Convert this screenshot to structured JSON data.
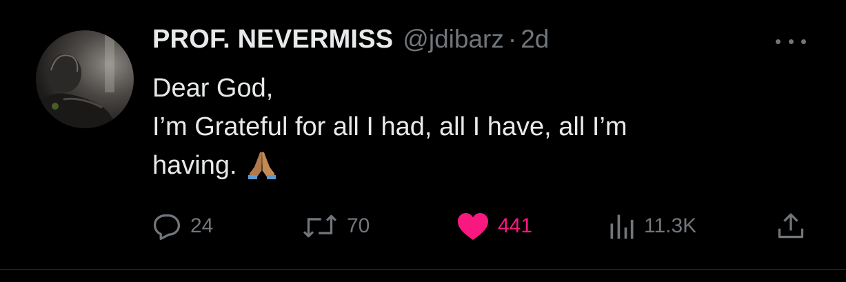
{
  "tweet": {
    "author_name": "PROF. NEVERMISS",
    "handle": "@jdibarz",
    "separator": "·",
    "time": "2d",
    "text_lines": [
      "Dear God,",
      "I’m Grateful for all I had, all I have, all I’m",
      "having."
    ],
    "emoji": "folded-hands-emoji"
  },
  "actions": {
    "reply_count": "24",
    "retweet_count": "70",
    "like_count": "441",
    "view_count": "11.3K"
  },
  "colors": {
    "background": "#000000",
    "primary_text": "#e7e9ea",
    "secondary_text": "#71767b",
    "like_active": "#f91880",
    "divider": "#2f3336"
  },
  "icons": {
    "more": "more-options-icon",
    "reply": "reply-icon",
    "retweet": "retweet-icon",
    "like": "heart-icon",
    "views": "views-icon",
    "share": "share-icon"
  }
}
